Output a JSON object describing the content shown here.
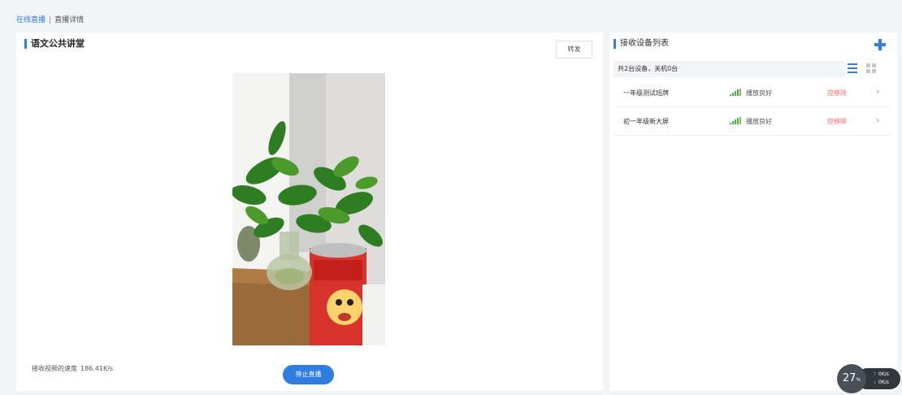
{
  "breadcrumb": {
    "parent": "在线直播",
    "separator": "|",
    "current": "直播详情"
  },
  "main": {
    "title": "语文公共讲堂",
    "forward_label": "转发",
    "speed_label": "接收视频的速度",
    "speed_value": "186.41K/s",
    "stop_label": "停止直播"
  },
  "side": {
    "title": "接收设备列表",
    "summary": "共2台设备，关机0台",
    "devices": [
      {
        "name": "一年级测试班牌",
        "status": "播放良好",
        "action": "应移除"
      },
      {
        "name": "初一年级新大屏",
        "status": "播放良好",
        "action": "应移除"
      }
    ]
  },
  "net_widget": {
    "percent": "27",
    "unit": "%",
    "up": "0K/s",
    "down": "0K/s"
  },
  "colors": {
    "accent": "#2f7de1",
    "danger": "#f56c6c",
    "signal": "#4caf50"
  }
}
